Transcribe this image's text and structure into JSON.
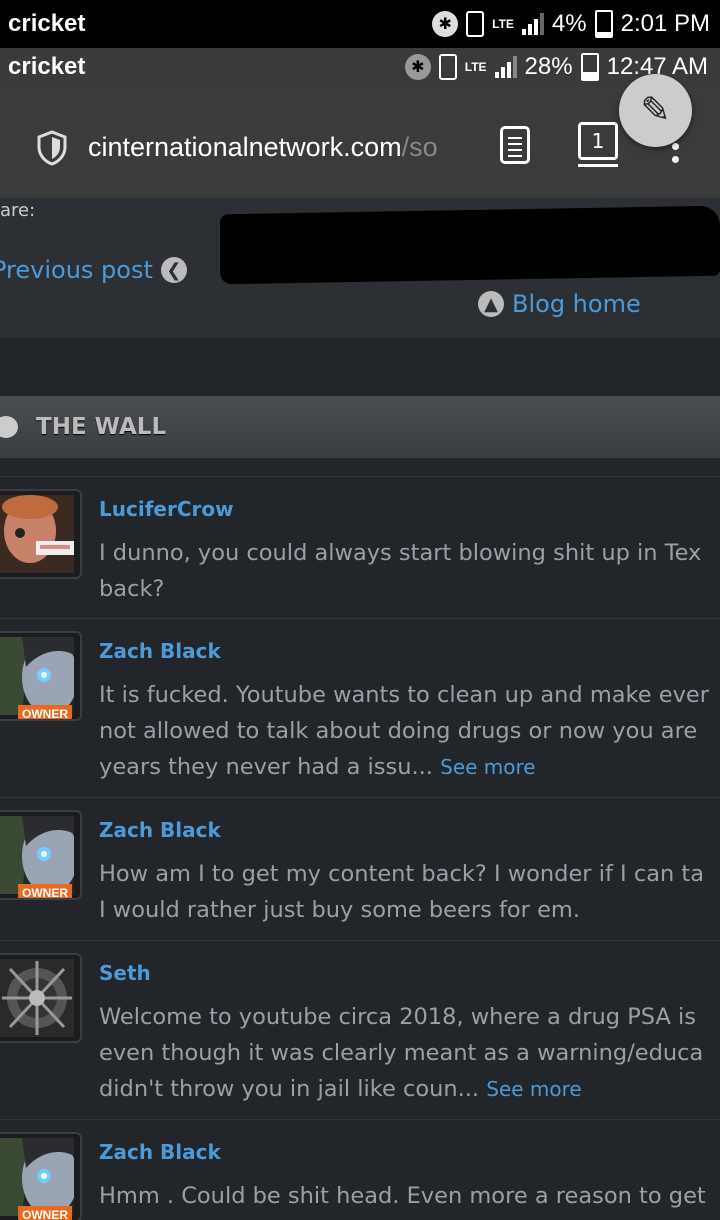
{
  "status_outer": {
    "carrier": "cricket",
    "lte": "LTE",
    "battery": "4%",
    "time": "2:01 PM"
  },
  "status_inner": {
    "carrier": "cricket",
    "lte": "LTE",
    "battery": "28%",
    "time": "12:47 AM"
  },
  "browser": {
    "url_main": "cinternationalnetwork.com",
    "url_tail": "/so",
    "tab_count": "1"
  },
  "post_nav": {
    "share_label": "are:",
    "prev_label": "Previous post",
    "blog_home_label": "Blog home"
  },
  "wall": {
    "title": "THE WALL"
  },
  "comments": [
    {
      "author": "LuciferCrow",
      "text": "I dunno, you could always start blowing shit up in Tex\nback?",
      "see_more": "",
      "owner_badge": ""
    },
    {
      "author": "Zach Black",
      "text": "It is fucked. Youtube wants to clean up and make ever\nnot allowed to talk about doing drugs or now you are\nyears they never had a issu... ",
      "see_more": "See more",
      "owner_badge": "OWNER"
    },
    {
      "author": "Zach Black",
      "text": "How am I to get my content back? I wonder if I can ta\nI would rather just buy some beers for em.",
      "see_more": "",
      "owner_badge": "OWNER"
    },
    {
      "author": "Seth",
      "text": "Welcome to youtube circa 2018, where a drug PSA is\neven though it was clearly meant as a warning/educa\ndidn't throw you in jail like coun... ",
      "see_more": "See more",
      "owner_badge": ""
    },
    {
      "author": "Zach Black",
      "text": "Hmm . Could be shit head. Even more a reason to get",
      "see_more": "",
      "owner_badge": "OWNER"
    }
  ],
  "colors": {
    "link": "#4c9ad8",
    "owner_badge": "#e86a20",
    "background": "#22252a"
  }
}
